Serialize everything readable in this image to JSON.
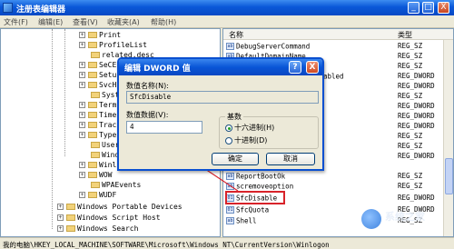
{
  "window": {
    "title": "注册表编辑器",
    "controls": {
      "minimize": "_",
      "maximize": "□",
      "close": "X"
    }
  },
  "menu": [
    "文件(F)",
    "编辑(E)",
    "查看(V)",
    "收藏夹(A)",
    "帮助(H)"
  ],
  "tree": {
    "items": [
      {
        "label": "Print"
      },
      {
        "label": "ProfileList"
      },
      {
        "label": "related.desc"
      },
      {
        "label": "SeCE"
      },
      {
        "label": "Setup"
      },
      {
        "label": "SvcH"
      },
      {
        "label": "Syst"
      },
      {
        "label": "Term"
      },
      {
        "label": "Time"
      },
      {
        "label": "Trac"
      },
      {
        "label": "Type"
      },
      {
        "label": "User"
      },
      {
        "label": "Wind"
      },
      {
        "label": "Winl"
      },
      {
        "label": "WOW"
      },
      {
        "label": "WPAEvents"
      },
      {
        "label": "WUDF"
      },
      {
        "label": "Windows Portable Devices"
      },
      {
        "label": "Windows Script Host"
      },
      {
        "label": "Windows Search"
      }
    ]
  },
  "list": {
    "headers": {
      "name": "名称",
      "type": "类型"
    },
    "rows": [
      {
        "name": "DebugServerCommand",
        "type": "REG_SZ"
      },
      {
        "name": "DefaultDomainName",
        "type": "REG_SZ"
      },
      {
        "name": "",
        "type": "REG_SZ"
      },
      {
        "name": "abled",
        "type": "REG_DWORD"
      },
      {
        "name": "",
        "type": "REG_DWORD"
      },
      {
        "name": "",
        "type": "REG_SZ"
      },
      {
        "name": "",
        "type": "REG_DWORD"
      },
      {
        "name": "",
        "type": "REG_DWORD"
      },
      {
        "name": "",
        "type": "REG_DWORD"
      },
      {
        "name": "",
        "type": "REG_SZ"
      },
      {
        "name": "",
        "type": "REG_SZ"
      },
      {
        "name": "",
        "type": "REG_DWORD"
      },
      {
        "name": "ReportBootOk",
        "type": "REG_SZ"
      },
      {
        "name": "scremoveoption",
        "type": "REG_SZ"
      },
      {
        "name": "SfcDisable",
        "type": "REG_DWORD"
      },
      {
        "name": "SfcQuota",
        "type": "REG_DWORD"
      },
      {
        "name": "Shell",
        "type": "REG_SZ"
      }
    ]
  },
  "status": "我的电脑\\HKEY_LOCAL_MACHINE\\SOFTWARE\\Microsoft\\Windows NT\\CurrentVersion\\Winlogon",
  "dialog": {
    "title": "编辑 DWORD 值",
    "help": "?",
    "close": "X",
    "name_label": "数值名称(N):",
    "name_value": "SfcDisable",
    "data_label": "数值数据(V):",
    "data_value": "4",
    "base_label": "基数",
    "hex_label": "十六进制(H)",
    "dec_label": "十进制(D)",
    "base_selected": "hex",
    "ok": "确定",
    "cancel": "取消"
  },
  "watermark": {
    "text": "系统之家"
  },
  "colors": {
    "title_blue": "#0a58d8",
    "highlight_red": "#d8232a"
  }
}
